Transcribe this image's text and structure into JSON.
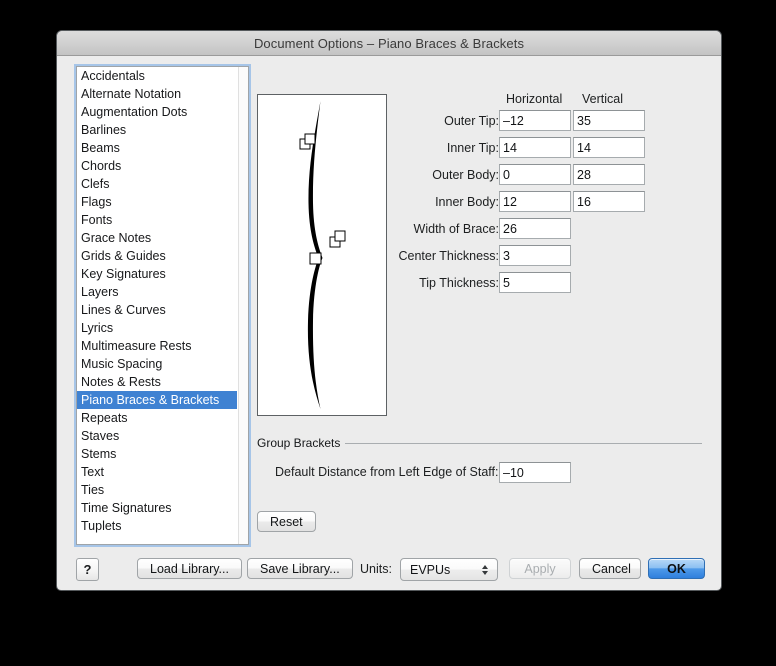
{
  "window": {
    "title": "Document Options – Piano Braces & Brackets"
  },
  "sidebar": {
    "items": [
      {
        "label": "Accidentals",
        "selected": false
      },
      {
        "label": "Alternate Notation",
        "selected": false
      },
      {
        "label": "Augmentation Dots",
        "selected": false
      },
      {
        "label": "Barlines",
        "selected": false
      },
      {
        "label": "Beams",
        "selected": false
      },
      {
        "label": "Chords",
        "selected": false
      },
      {
        "label": "Clefs",
        "selected": false
      },
      {
        "label": "Flags",
        "selected": false
      },
      {
        "label": "Fonts",
        "selected": false
      },
      {
        "label": "Grace Notes",
        "selected": false
      },
      {
        "label": "Grids & Guides",
        "selected": false
      },
      {
        "label": "Key Signatures",
        "selected": false
      },
      {
        "label": "Layers",
        "selected": false
      },
      {
        "label": "Lines & Curves",
        "selected": false
      },
      {
        "label": "Lyrics",
        "selected": false
      },
      {
        "label": "Multimeasure Rests",
        "selected": false
      },
      {
        "label": "Music Spacing",
        "selected": false
      },
      {
        "label": "Notes & Rests",
        "selected": false
      },
      {
        "label": "Piano Braces & Brackets",
        "selected": true
      },
      {
        "label": "Repeats",
        "selected": false
      },
      {
        "label": "Staves",
        "selected": false
      },
      {
        "label": "Stems",
        "selected": false
      },
      {
        "label": "Text",
        "selected": false
      },
      {
        "label": "Ties",
        "selected": false
      },
      {
        "label": "Time Signatures",
        "selected": false
      },
      {
        "label": "Tuplets",
        "selected": false
      }
    ]
  },
  "preview": {
    "name": "piano-brace-preview"
  },
  "form": {
    "column_headers": {
      "horizontal": "Horizontal",
      "vertical": "Vertical"
    },
    "rows": [
      {
        "label": "Outer Tip:",
        "horizontal": "–12",
        "vertical": "35",
        "has_vertical": true
      },
      {
        "label": "Inner Tip:",
        "horizontal": "14",
        "vertical": "14",
        "has_vertical": true
      },
      {
        "label": "Outer Body:",
        "horizontal": "0",
        "vertical": "28",
        "has_vertical": true
      },
      {
        "label": "Inner Body:",
        "horizontal": "12",
        "vertical": "16",
        "has_vertical": true
      },
      {
        "label": "Width of Brace:",
        "horizontal": "26",
        "vertical": "",
        "has_vertical": false
      },
      {
        "label": "Center Thickness:",
        "horizontal": "3",
        "vertical": "",
        "has_vertical": false
      },
      {
        "label": "Tip Thickness:",
        "horizontal": "5",
        "vertical": "",
        "has_vertical": false
      }
    ]
  },
  "group_brackets": {
    "legend": "Group Brackets",
    "default_distance_label": "Default Distance from Left Edge of Staff:",
    "default_distance_value": "–10",
    "reset_label": "Reset"
  },
  "bottom_bar": {
    "help_label": "?",
    "load_library_label": "Load Library...",
    "save_library_label": "Save Library...",
    "units_label": "Units:",
    "units_value": "EVPUs",
    "apply_label": "Apply",
    "cancel_label": "Cancel",
    "ok_label": "OK"
  },
  "colors": {
    "dialog_background": "#ececec",
    "selection_blue": "#3f82d2",
    "default_button_blue": "#2f7fdd",
    "page_background": "#000000"
  }
}
